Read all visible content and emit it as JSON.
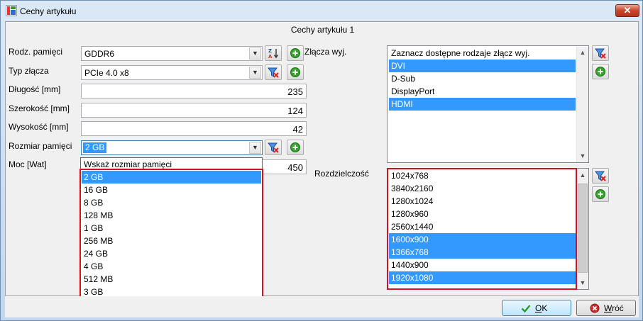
{
  "window": {
    "title": "Cechy artykułu",
    "close_glyph": "✕"
  },
  "header": {
    "title": "Cechy artykułu 1"
  },
  "fields": {
    "memory_type": {
      "label": "Rodz. pamięci",
      "value": "GDDR6"
    },
    "connector_type": {
      "label": "Typ złącza",
      "value": "PCIe 4.0 x8"
    },
    "length": {
      "label": "Długość [mm]",
      "value": "235"
    },
    "width": {
      "label": "Szerokość [mm]",
      "value": "124"
    },
    "height": {
      "label": "Wysokość [mm]",
      "value": "42"
    },
    "memory_size": {
      "label": "Rozmiar pamięci",
      "value": "2 GB"
    },
    "power": {
      "label": "Moc [Wat]",
      "value": "450"
    }
  },
  "memory_size_dropdown": {
    "options": [
      "Wskaż rozmiar pamięci",
      "2 GB",
      "16 GB",
      "8 GB",
      "128 MB",
      "1 GB",
      "256 MB",
      "24 GB",
      "4 GB",
      "512 MB",
      "3 GB"
    ],
    "selected": "2 GB"
  },
  "outputs": {
    "label": "Złącza wyj.",
    "header": "Zaznacz dostępne rodzaje złącz wyj.",
    "items": [
      {
        "label": "DVI",
        "selected": true
      },
      {
        "label": "D-Sub",
        "selected": false
      },
      {
        "label": "DisplayPort",
        "selected": false
      },
      {
        "label": "HDMI",
        "selected": true
      }
    ]
  },
  "resolution": {
    "label": "Rozdzielczość",
    "items": [
      {
        "label": "1024x768",
        "selected": false
      },
      {
        "label": "3840x2160",
        "selected": false
      },
      {
        "label": "1280x1024",
        "selected": false
      },
      {
        "label": "1280x960",
        "selected": false
      },
      {
        "label": "2560x1440",
        "selected": false
      },
      {
        "label": "1600x900",
        "selected": true
      },
      {
        "label": "1366x768",
        "selected": true
      },
      {
        "label": "1440x900",
        "selected": false
      },
      {
        "label": "1920x1080",
        "selected": true
      }
    ]
  },
  "buttons": {
    "ok_mnemonic": "O",
    "ok_rest": "K",
    "back_mnemonic": "W",
    "back_rest": "róć"
  },
  "icons": {
    "sort": "sort-az-icon",
    "filter": "filter-clear-icon",
    "add": "add-icon",
    "check": "check-icon",
    "cancel": "cancel-icon"
  },
  "colors": {
    "selection": "#3399ff",
    "highlight_frame": "#d6121e"
  }
}
